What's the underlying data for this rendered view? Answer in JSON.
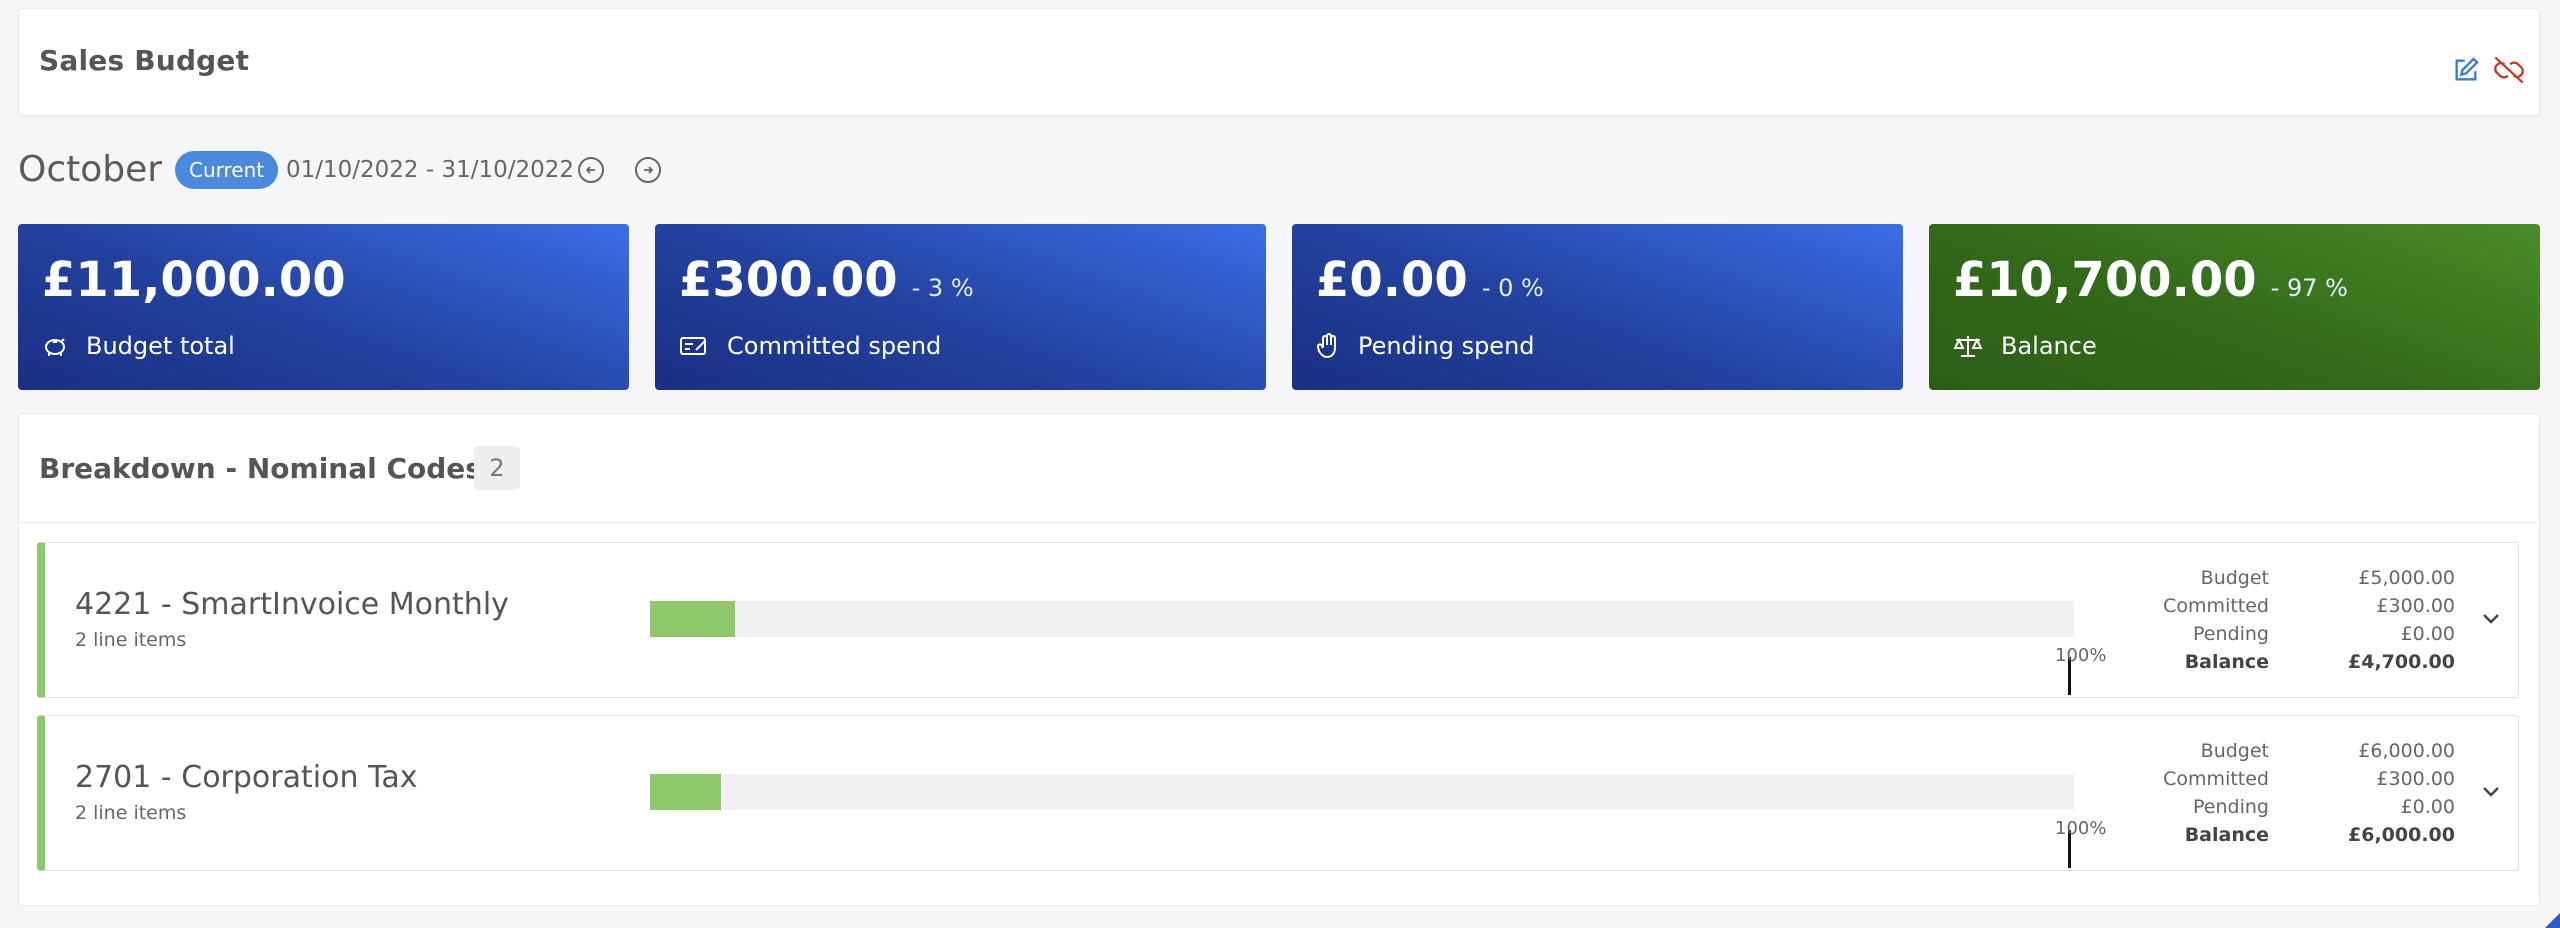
{
  "header": {
    "title": "Sales Budget",
    "edit_icon": "edit-icon",
    "unlink_icon": "unlink-icon"
  },
  "period": {
    "month": "October",
    "badge": "Current",
    "range": "01/10/2022 - 31/10/2022"
  },
  "stats": [
    {
      "value": "£11,000.00",
      "pct": "",
      "label": "Budget total",
      "icon": "piggy-bank-icon",
      "color": "#23429f"
    },
    {
      "value": "£300.00",
      "pct": "- 3 %",
      "label": "Committed spend",
      "icon": "cheque-icon",
      "color": "#23429f"
    },
    {
      "value": "£0.00",
      "pct": "- 0 %",
      "label": "Pending spend",
      "icon": "hand-icon",
      "color": "#23429f"
    },
    {
      "value": "£10,700.00",
      "pct": "- 97 %",
      "label": "Balance",
      "icon": "scales-icon",
      "color": "#336a1a"
    }
  ],
  "breakdown": {
    "title": "Breakdown - Nominal Codes",
    "count": "2",
    "rows": [
      {
        "name": "4221 - SmartInvoice Monthly",
        "sub": "2 line items",
        "progress_fraction": 0.06,
        "bar_label": "100%",
        "budget_label": "Budget",
        "budget": "£5,000.00",
        "committed_label": "Committed",
        "committed": "£300.00",
        "pending_label": "Pending",
        "pending": "£0.00",
        "balance_label": "Balance",
        "balance": "£4,700.00"
      },
      {
        "name": "2701 - Corporation Tax",
        "sub": "2 line items",
        "progress_fraction": 0.05,
        "bar_label": "100%",
        "budget_label": "Budget",
        "budget": "£6,000.00",
        "committed_label": "Committed",
        "committed": "£300.00",
        "pending_label": "Pending",
        "pending": "£0.00",
        "balance_label": "Balance",
        "balance": "£6,000.00"
      }
    ]
  },
  "colors": {
    "accent_blue": "#4a89dc",
    "progress_green": "#8dc96a",
    "balance_green": "#336a1a"
  }
}
